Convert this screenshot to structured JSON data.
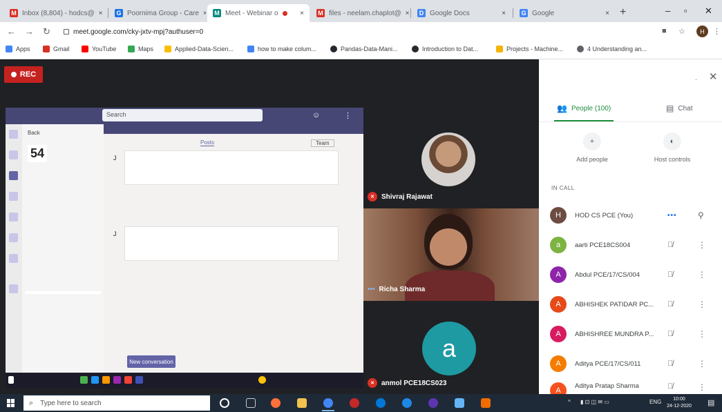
{
  "browser": {
    "tabs": [
      {
        "label": "Inbox (8,804) - hodcs@",
        "favicon_color": "#d93025",
        "favicon_glyph": "M"
      },
      {
        "label": "Poornima Group - Care",
        "favicon_color": "#1a73e8",
        "favicon_glyph": "G"
      },
      {
        "label": "Meet - Webinar o",
        "favicon_color": "#00897b",
        "favicon_glyph": "M"
      },
      {
        "label": "files - neelam.chaplot@",
        "favicon_color": "#d93025",
        "favicon_glyph": "M"
      },
      {
        "label": "Google Docs",
        "favicon_color": "#4285f4",
        "favicon_glyph": "D"
      },
      {
        "label": "Google",
        "favicon_color": "#4285f4",
        "favicon_glyph": "G"
      }
    ],
    "url": "meet.google.com/cky-jxtv-mpj?authuser=0",
    "profile_initial": "H",
    "bookmarks": [
      {
        "label": "Apps",
        "color": "#4285f4"
      },
      {
        "label": "Gmail",
        "color": "#d93025"
      },
      {
        "label": "YouTube",
        "color": "#ff0000"
      },
      {
        "label": "Maps",
        "color": "#34a853"
      },
      {
        "label": "Applied-Data-Scien...",
        "color": "#fbbc04"
      },
      {
        "label": "how to make colum...",
        "color": "#4285f4"
      },
      {
        "label": "Pandas-Data-Mani...",
        "color": "#24292e"
      },
      {
        "label": "Introduction to Dat...",
        "color": "#24292e"
      },
      {
        "label": "Projects - Machine...",
        "color": "#f4b400"
      },
      {
        "label": "4 Understanding an...",
        "color": "#5f6368"
      }
    ]
  },
  "meet": {
    "rec_label": "REC",
    "participants_tiles": [
      {
        "name": "Shivraj Rajawat"
      },
      {
        "name": "Richa Sharma"
      },
      {
        "name": "anmol PCE18CS023",
        "initial": "a"
      }
    ],
    "shared_screen": {
      "search_placeholder": "Search",
      "banner": "",
      "channel_title": "",
      "tab_label": "Posts",
      "meta_label": "Team",
      "left_count": "54",
      "left_lines": [
        "Back",
        "",
        "",
        "",
        "",
        "",
        "",
        "",
        ""
      ],
      "left_highlight": "",
      "posts": [
        {
          "title": "",
          "meeting": ""
        },
        {
          "title": "",
          "meeting": ""
        }
      ],
      "date_separator": "",
      "new_conversation": "New conversation"
    }
  },
  "people_panel": {
    "people_tab": "People (100)",
    "chat_tab": "Chat",
    "add_people": "Add people",
    "host_controls": "Host controls",
    "in_call": "IN CALL",
    "list": [
      {
        "name": "HOD CS PCE (You)",
        "initial": "H",
        "color": "#6d4c41",
        "talking": true
      },
      {
        "name": "aarti PCE18CS004",
        "initial": "a",
        "color": "#7cb342",
        "talking": false
      },
      {
        "name": "Abdul PCE/17/CS/004",
        "initial": "A",
        "color": "#8e24aa",
        "talking": false
      },
      {
        "name": "ABHISHEK PATIDAR PC...",
        "initial": "A",
        "color": "#e64a19",
        "talking": false
      },
      {
        "name": "ABHISHREE MUNDRA P...",
        "initial": "A",
        "color": "#d81b60",
        "talking": false
      },
      {
        "name": "Aditya PCE/17/CS/011",
        "initial": "A",
        "color": "#f57c00",
        "talking": false
      },
      {
        "name": "Aditya Pratap Sharma",
        "initial": "A",
        "color": "#f4511e",
        "talking": false
      }
    ]
  },
  "taskbar": {
    "search_placeholder": "Type here to search",
    "language": "ENG",
    "time": "10:00",
    "date": "24-12-2020"
  }
}
